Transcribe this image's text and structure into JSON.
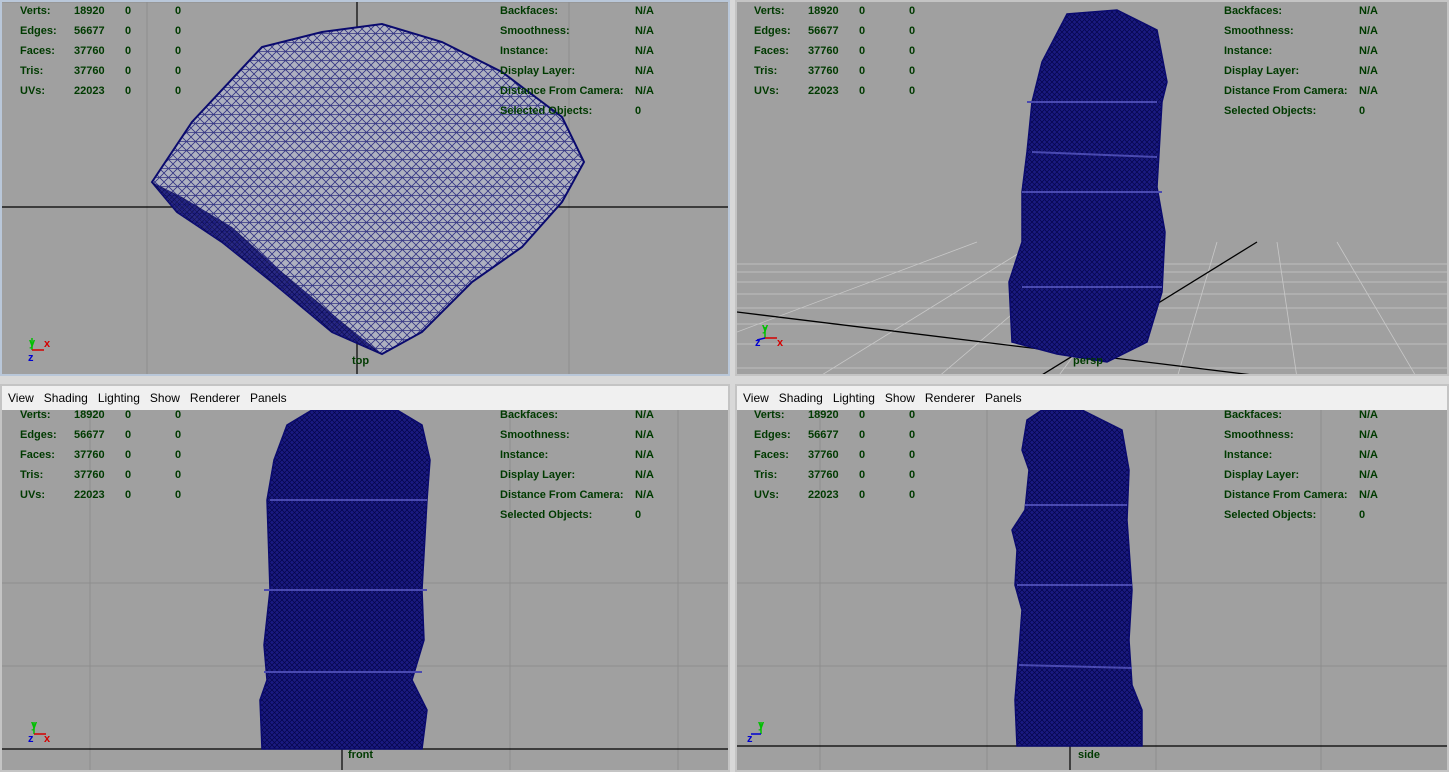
{
  "menu": [
    "View",
    "Shading",
    "Lighting",
    "Show",
    "Renderer",
    "Panels"
  ],
  "stats": {
    "rows": [
      {
        "label": "Verts:",
        "v1": "18920",
        "v2": "0",
        "v3": "0"
      },
      {
        "label": "Edges:",
        "v1": "56677",
        "v2": "0",
        "v3": "0"
      },
      {
        "label": "Faces:",
        "v1": "37760",
        "v2": "0",
        "v3": "0"
      },
      {
        "label": "Tris:",
        "v1": "37760",
        "v2": "0",
        "v3": "0"
      },
      {
        "label": "UVs:",
        "v1": "22023",
        "v2": "0",
        "v3": "0"
      }
    ]
  },
  "info": {
    "rows": [
      {
        "label": "Backfaces:",
        "value": "N/A"
      },
      {
        "label": "Smoothness:",
        "value": "N/A"
      },
      {
        "label": "Instance:",
        "value": "N/A"
      },
      {
        "label": "Display Layer:",
        "value": "N/A"
      },
      {
        "label": "Distance From Camera:",
        "value": "N/A"
      },
      {
        "label": "Selected Objects:",
        "value": "0"
      }
    ]
  },
  "viewports": {
    "top": {
      "camera": "top"
    },
    "persp": {
      "camera": "persp"
    },
    "front": {
      "camera": "front"
    },
    "side": {
      "camera": "side"
    }
  },
  "axis_labels": {
    "x": "x",
    "y": "y",
    "z": "z"
  },
  "colors": {
    "wire": "#0a0a6e",
    "viewport_bg": "#a0a0a0",
    "hud_text": "#003a00",
    "axis_x": "#d40000",
    "axis_y": "#00c000",
    "axis_z": "#0000d0"
  }
}
